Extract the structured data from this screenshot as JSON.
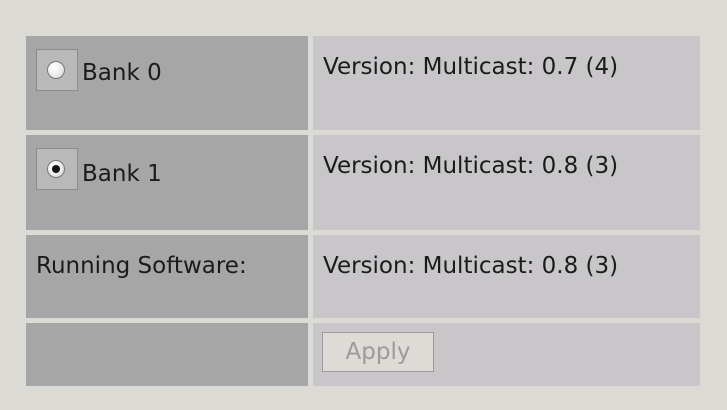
{
  "banks": [
    {
      "label": "Bank 0",
      "version_text": "Version: Multicast: 0.7 (4)",
      "selected": false
    },
    {
      "label": "Bank 1",
      "version_text": "Version: Multicast: 0.8 (3)",
      "selected": true
    }
  ],
  "running_software": {
    "label": "Running Software:",
    "version_text": "Version: Multicast: 0.8 (3)"
  },
  "actions": {
    "apply_label": "Apply",
    "apply_enabled": false
  }
}
